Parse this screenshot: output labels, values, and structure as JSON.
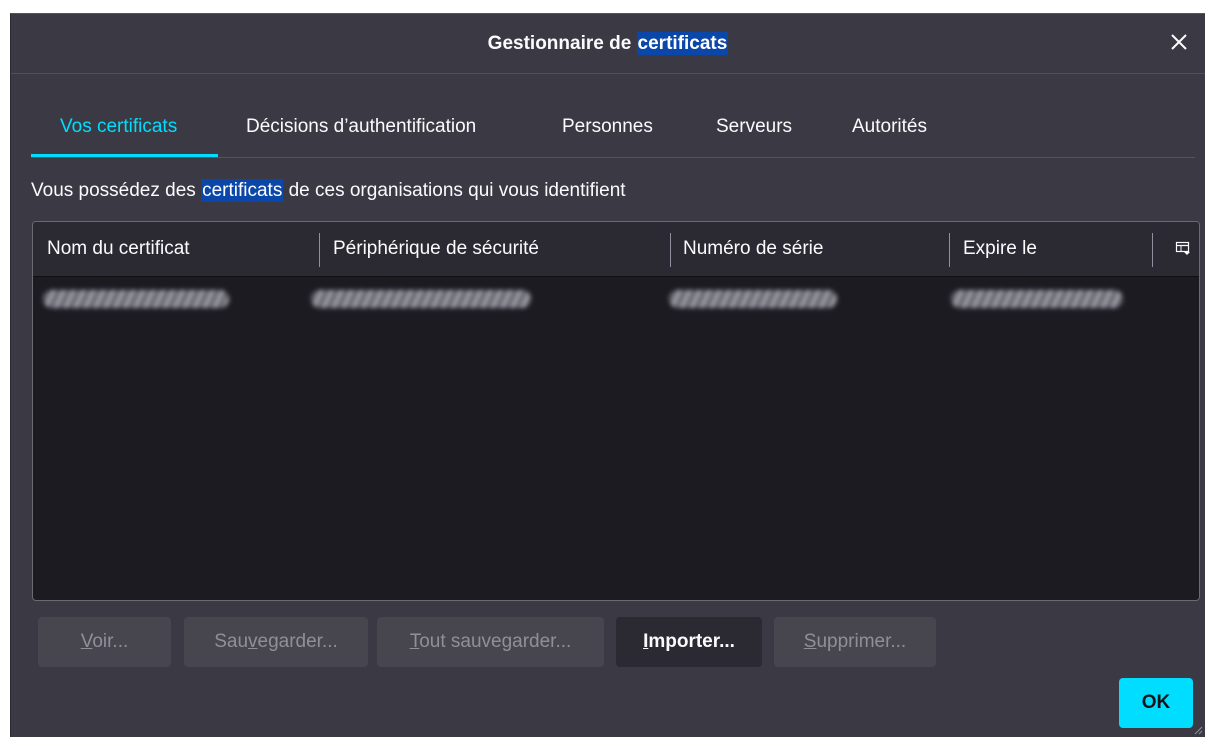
{
  "dialog": {
    "title_prefix": "Gestionnaire de ",
    "title_highlight": "certificats",
    "close_icon": "close-icon"
  },
  "tabs": [
    {
      "label": "Vos certificats",
      "selected": true
    },
    {
      "label": "Décisions d’authentification",
      "selected": false
    },
    {
      "label": "Personnes",
      "selected": false
    },
    {
      "label": "Serveurs",
      "selected": false
    },
    {
      "label": "Autorités",
      "selected": false
    }
  ],
  "intro": {
    "prefix": "Vous possédez des ",
    "highlight": "certificats",
    "suffix": " de ces organisations qui vous identifient"
  },
  "table": {
    "columns": [
      "Nom du certificat",
      "Périphérique de sécurité",
      "Numéro de série",
      "Expire le"
    ],
    "column_picker_icon": "column-picker-icon",
    "rows_redacted": true
  },
  "buttons": {
    "view": {
      "accel": "V",
      "rest": "oir...",
      "enabled": false
    },
    "backup": {
      "pre": "Sau",
      "accel": "v",
      "post": "egarder...",
      "enabled": false
    },
    "backup_all": {
      "accel": "T",
      "rest": "out sauvegarder...",
      "enabled": false
    },
    "import": {
      "accel": "I",
      "rest": "mporter...",
      "enabled": true
    },
    "delete": {
      "accel": "S",
      "rest": "upprimer...",
      "enabled": false
    },
    "ok": "OK"
  },
  "colors": {
    "accent": "#00ddff",
    "dialog_bg": "#3b3a44",
    "table_bg": "#1c1b22",
    "highlight": "#0a47a8"
  }
}
